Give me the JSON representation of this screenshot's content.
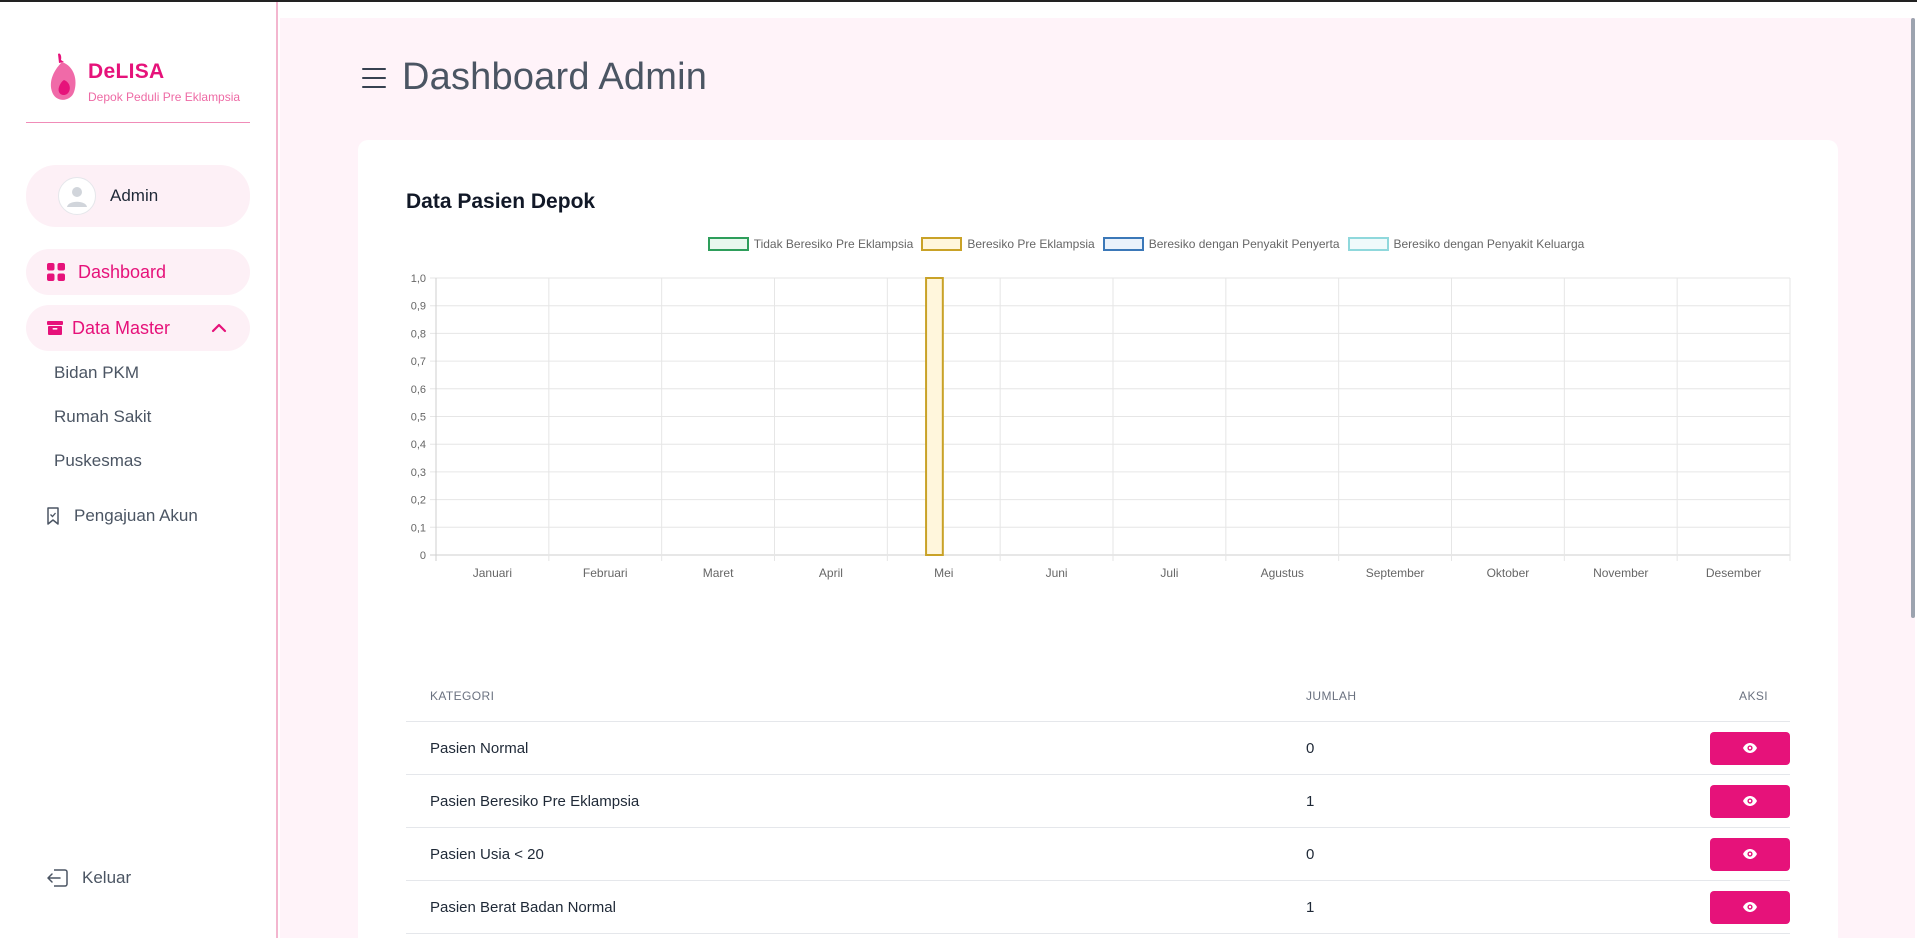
{
  "brand": {
    "name": "DeLISA",
    "tagline": "Depok Peduli Pre Eklampsia"
  },
  "user": {
    "name": "Admin"
  },
  "sidebar": {
    "dashboard": "Dashboard",
    "data_master": "Data Master",
    "sub_items": [
      "Bidan PKM",
      "Rumah Sakit",
      "Puskesmas"
    ],
    "pengajuan": "Pengajuan Akun",
    "logout": "Keluar"
  },
  "header": {
    "title": "Dashboard Admin"
  },
  "card": {
    "title": "Data Pasien Depok"
  },
  "colors": {
    "accent": "#e6127a",
    "series": [
      {
        "border": "#2e9e5b",
        "fill": "#e8f8ee"
      },
      {
        "border": "#c9a227",
        "fill": "#fff6dc"
      },
      {
        "border": "#3b78b8",
        "fill": "#eaf2fb"
      },
      {
        "border": "#8fd8dc",
        "fill": "#effafb"
      }
    ]
  },
  "chart_data": {
    "type": "bar",
    "categories": [
      "Januari",
      "Februari",
      "Maret",
      "April",
      "Mei",
      "Juni",
      "Juli",
      "Agustus",
      "September",
      "Oktober",
      "November",
      "Desember"
    ],
    "series": [
      {
        "name": "Tidak Beresiko Pre Eklampsia",
        "values": [
          0,
          0,
          0,
          0,
          0,
          0,
          0,
          0,
          0,
          0,
          0,
          0
        ]
      },
      {
        "name": "Beresiko Pre Eklampsia",
        "values": [
          0,
          0,
          0,
          0,
          1,
          0,
          0,
          0,
          0,
          0,
          0,
          0
        ]
      },
      {
        "name": "Beresiko dengan Penyakit Penyerta",
        "values": [
          0,
          0,
          0,
          0,
          0,
          0,
          0,
          0,
          0,
          0,
          0,
          0
        ]
      },
      {
        "name": "Beresiko dengan Penyakit Keluarga",
        "values": [
          0,
          0,
          0,
          0,
          0,
          0,
          0,
          0,
          0,
          0,
          0,
          0
        ]
      }
    ],
    "ylim": [
      0,
      1.0
    ],
    "yticks": [
      "0",
      "0,1",
      "0,2",
      "0,3",
      "0,4",
      "0,5",
      "0,6",
      "0,7",
      "0,8",
      "0,9",
      "1,0"
    ],
    "grid": true,
    "legend": "top"
  },
  "table": {
    "headers": {
      "kategori": "KATEGORI",
      "jumlah": "JUMLAH",
      "aksi": "AKSI"
    },
    "rows": [
      {
        "kategori": "Pasien Normal",
        "jumlah": "0"
      },
      {
        "kategori": "Pasien Beresiko Pre Eklampsia",
        "jumlah": "1"
      },
      {
        "kategori": "Pasien Usia < 20",
        "jumlah": "0"
      },
      {
        "kategori": "Pasien Berat Badan Normal",
        "jumlah": "1"
      }
    ]
  }
}
